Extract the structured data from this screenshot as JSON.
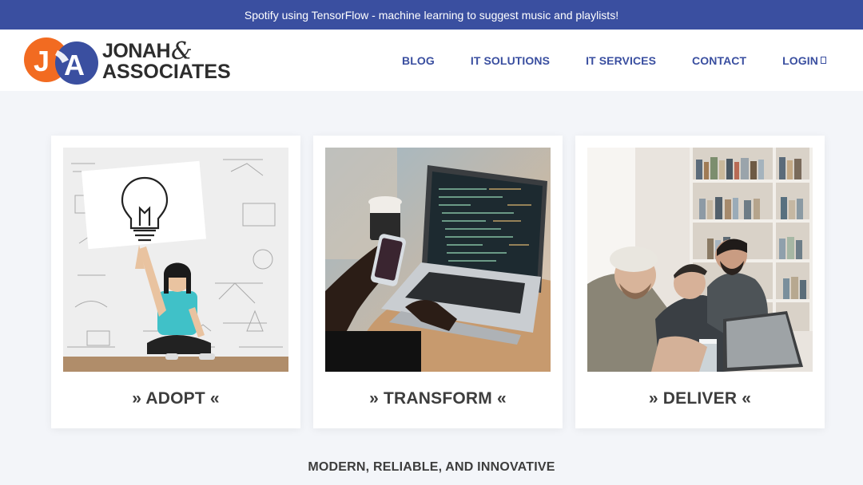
{
  "announcement": {
    "text": "Spotify using TensorFlow - machine learning to suggest music and playlists!"
  },
  "brand": {
    "initials": "JA",
    "line1": "JONAH",
    "ampersand": "&",
    "line2": "ASSOCIATES"
  },
  "nav": {
    "items": [
      {
        "label": "BLOG"
      },
      {
        "label": "IT SOLUTIONS"
      },
      {
        "label": "IT SERVICES"
      },
      {
        "label": "CONTACT"
      },
      {
        "label": "LOGIN",
        "icon": "lock-icon"
      }
    ]
  },
  "cards": [
    {
      "title": "» ADOPT «"
    },
    {
      "title": "» TRANSFORM «"
    },
    {
      "title": "» DELIVER «"
    }
  ],
  "tagline": "MODERN, RELIABLE, AND INNOVATIVE",
  "colors": {
    "accent": "#3a4fa0",
    "orange": "#f26b21",
    "text": "#3d3d3d",
    "background": "#f3f5f9"
  }
}
